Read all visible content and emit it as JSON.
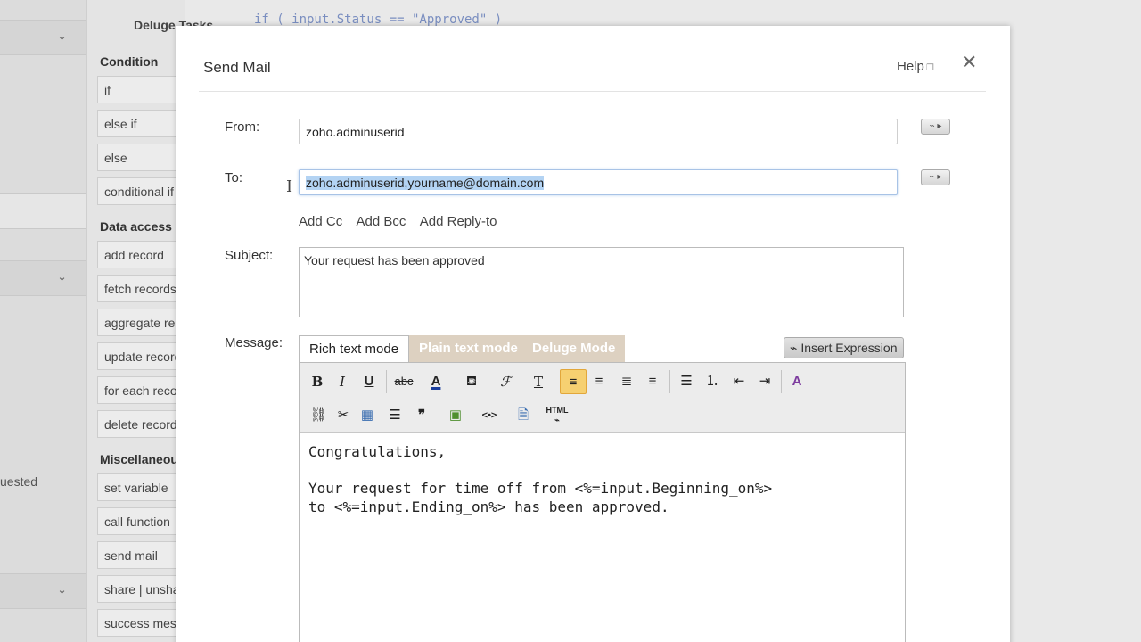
{
  "background": {
    "tasks_title": "Deluge Tasks",
    "code_line": "if ( input.Status == \"Approved\" )",
    "requested_text": "uested",
    "sections": [
      {
        "title": "Condition",
        "items": [
          "if",
          "else if",
          "else",
          "conditional if"
        ]
      },
      {
        "title": "Data access",
        "items": [
          "add record",
          "fetch records",
          "aggregate records",
          "update record",
          "for each record",
          "delete record"
        ]
      },
      {
        "title": "Miscellaneous",
        "items": [
          "set variable",
          "call function",
          "send mail",
          "share | unshare",
          "success message"
        ]
      }
    ]
  },
  "dialog": {
    "title": "Send Mail",
    "help": "Help",
    "close": "✕",
    "from_label": "From:",
    "from_value": "zoho.adminuserid",
    "to_label": "To:",
    "to_value": "zoho.adminuserid,yourname@domain.com",
    "add_links": [
      "Add Cc",
      "Add Bcc",
      "Add Reply-to"
    ],
    "subject_label": "Subject:",
    "subject_value": "Your request has been approved",
    "message_label": "Message:",
    "tabs": [
      "Rich text mode",
      "Plain text mode",
      "Deluge Mode"
    ],
    "insert_expression": "Insert Expression",
    "message_body": "Congratulations,\n\nYour request for time off from <%=input.Beginning_on%>\nto <%=input.Ending_on%> has been approved."
  },
  "toolbar": {
    "row1": [
      "bold",
      "italic",
      "underline",
      "strikethrough",
      "font-color",
      "background-color",
      "font-family",
      "font-size",
      "align-left",
      "align-right",
      "justify",
      "align-center",
      "bullet-list",
      "numbered-list",
      "outdent",
      "indent",
      "clear-format"
    ],
    "row2": [
      "link",
      "unlink",
      "table",
      "horizontal-rule",
      "blockquote",
      "image",
      "embed-code",
      "insert-file",
      "html-source"
    ]
  },
  "colors": {
    "selection": "#b3d3f3",
    "active_button": "#f6d071",
    "inactive_tab": "#ddd1c1"
  }
}
